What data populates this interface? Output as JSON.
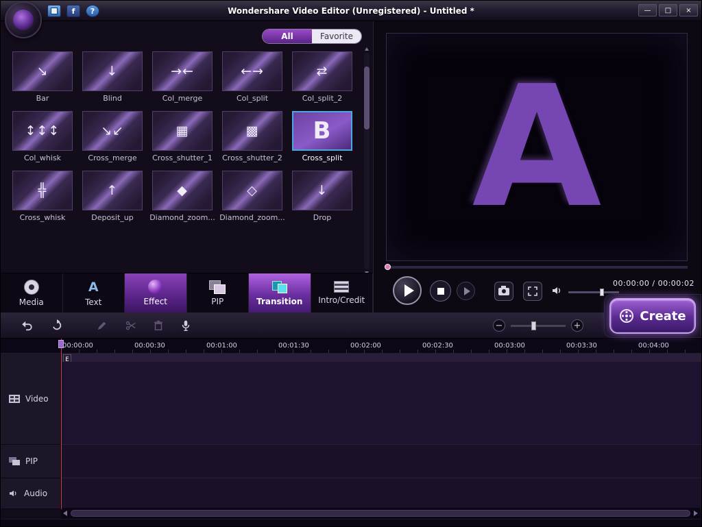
{
  "titlebar": {
    "title": "Wondershare Video Editor (Unregistered) - Untitled *",
    "facebook_label": "f",
    "help_label": "?",
    "controls": {
      "minimize": "—",
      "maximize": "□",
      "close": "×"
    }
  },
  "library": {
    "tabs": [
      {
        "label": "All"
      },
      {
        "label": "Favorite"
      }
    ],
    "selected_item": "Cross_split",
    "items": [
      {
        "name": "Bar",
        "glyph": "↘"
      },
      {
        "name": "Blind",
        "glyph": "↓"
      },
      {
        "name": "Col_merge",
        "glyph": "→←"
      },
      {
        "name": "Col_split",
        "glyph": "←→"
      },
      {
        "name": "Col_split_2",
        "glyph": "⇄"
      },
      {
        "name": "Col_whisk",
        "glyph": "↕↕↕"
      },
      {
        "name": "Cross_merge",
        "glyph": "↘↙"
      },
      {
        "name": "Cross_shutter_1",
        "glyph": "▦"
      },
      {
        "name": "Cross_shutter_2",
        "glyph": "▩"
      },
      {
        "name": "Cross_split",
        "glyph": "B"
      },
      {
        "name": "Cross_whisk",
        "glyph": "╬"
      },
      {
        "name": "Deposit_up",
        "glyph": "↑"
      },
      {
        "name": "Diamond_zoom...",
        "glyph": "◆"
      },
      {
        "name": "Diamond_zoom...",
        "glyph": "◇"
      },
      {
        "name": "Drop",
        "glyph": "↓"
      }
    ]
  },
  "mode_tabs": [
    {
      "label": "Media"
    },
    {
      "label": "Text",
      "icon_glyph": "A"
    },
    {
      "label": "Effect"
    },
    {
      "label": "PIP"
    },
    {
      "label": "Transition"
    },
    {
      "label": "Intro/Credit"
    }
  ],
  "preview": {
    "letter": "A",
    "time": "00:00:00 / 00:00:02"
  },
  "create": {
    "label": "Create"
  },
  "timeline": {
    "ruler": [
      "00:00:00",
      "00:00:30",
      "00:01:00",
      "00:01:30",
      "00:02:00",
      "00:02:30",
      "00:03:00",
      "00:03:30",
      "00:04:00"
    ],
    "tracks": [
      "Video",
      "PIP",
      "Audio"
    ],
    "clip_marker": "E"
  },
  "colors": {
    "accent": "#8a3ac8",
    "selection": "#4aa8e0",
    "playhead": "#d03848"
  }
}
